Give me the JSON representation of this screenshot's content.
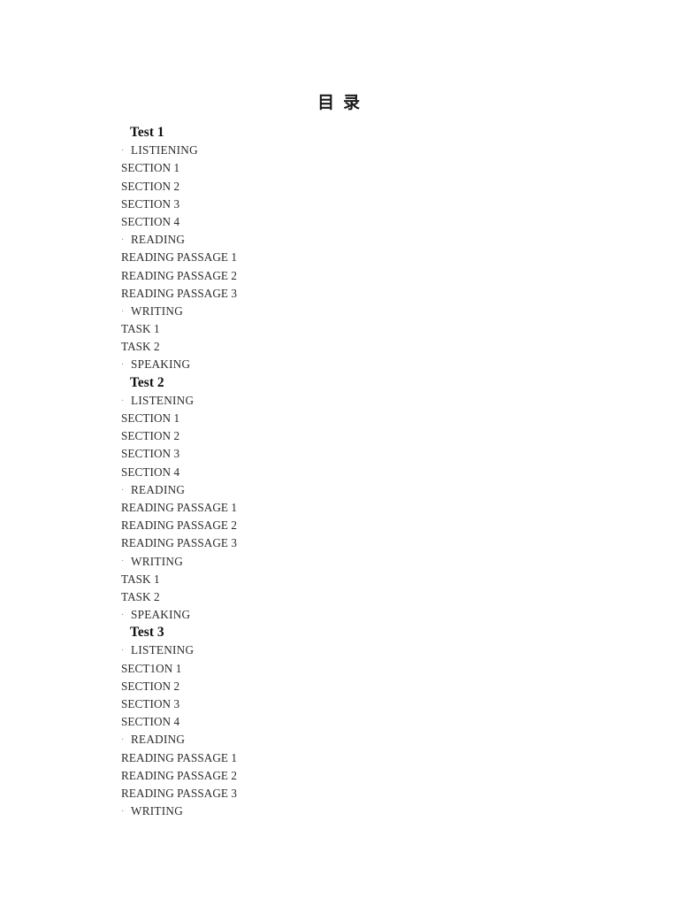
{
  "document": {
    "title": "目 录",
    "title_romanized_meaning": "Table of Contents"
  },
  "bullet_glyph": "·",
  "contents": [
    {
      "heading": "Test 1",
      "entries": [
        {
          "level": "section",
          "label": "LISTIENING"
        },
        {
          "level": "item",
          "label": "SECTION 1"
        },
        {
          "level": "item",
          "label": "SECTION 2"
        },
        {
          "level": "item",
          "label": "SECTION 3"
        },
        {
          "level": "item",
          "label": "SECTION 4"
        },
        {
          "level": "section",
          "label": "READING"
        },
        {
          "level": "item",
          "label": "READING PASSAGE 1"
        },
        {
          "level": "item",
          "label": "READING PASSAGE 2"
        },
        {
          "level": "item",
          "label": "READING PASSAGE 3"
        },
        {
          "level": "section",
          "label": "WRITING"
        },
        {
          "level": "item",
          "label": "TASK 1"
        },
        {
          "level": "item",
          "label": "TASK 2"
        },
        {
          "level": "section",
          "label": "SPEAKING"
        }
      ]
    },
    {
      "heading": "Test 2",
      "entries": [
        {
          "level": "section",
          "label": "LISTENING"
        },
        {
          "level": "item",
          "label": "SECTION 1"
        },
        {
          "level": "item",
          "label": "SECTION 2"
        },
        {
          "level": "item",
          "label": "SECTION 3"
        },
        {
          "level": "item",
          "label": "SECTION 4"
        },
        {
          "level": "section",
          "label": "READING"
        },
        {
          "level": "item",
          "label": "READING PASSAGE 1"
        },
        {
          "level": "item",
          "label": "READING PASSAGE 2"
        },
        {
          "level": "item",
          "label": "READING PASSAGE 3"
        },
        {
          "level": "section",
          "label": "WRITING"
        },
        {
          "level": "item",
          "label": "TASK 1"
        },
        {
          "level": "item",
          "label": "TASK 2"
        },
        {
          "level": "section",
          "label": "SPEAKING"
        }
      ]
    },
    {
      "heading": "Test 3",
      "entries": [
        {
          "level": "section",
          "label": "LISTENING"
        },
        {
          "level": "item",
          "label": "SECT1ON 1"
        },
        {
          "level": "item",
          "label": "SECTION 2"
        },
        {
          "level": "item",
          "label": "SECTION 3"
        },
        {
          "level": "item",
          "label": "SECTION 4"
        },
        {
          "level": "section",
          "label": "READING"
        },
        {
          "level": "item",
          "label": "READING PASSAGE 1"
        },
        {
          "level": "item",
          "label": "READING PASSAGE 2"
        },
        {
          "level": "item",
          "label": "READING PASSAGE 3"
        },
        {
          "level": "section",
          "label": "WRITING"
        }
      ]
    }
  ]
}
